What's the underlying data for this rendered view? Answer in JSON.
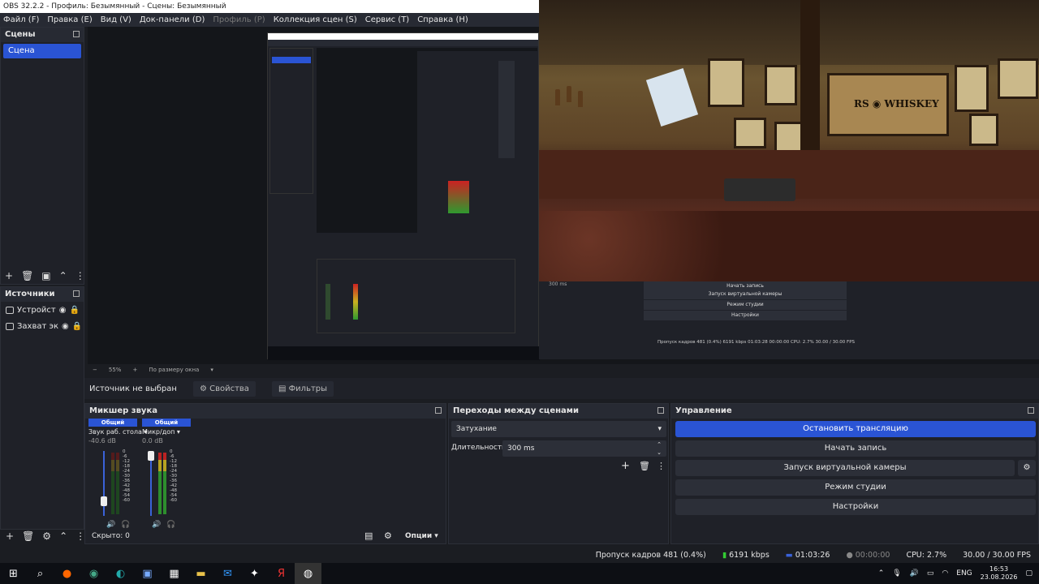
{
  "window": {
    "title": "OBS 32.2.2 - Профиль: Безымянный - Сцены: Безымянный"
  },
  "menu": {
    "items": [
      {
        "label": "Файл (F)",
        "disabled": false
      },
      {
        "label": "Правка (E)",
        "disabled": false
      },
      {
        "label": "Вид (V)",
        "disabled": false
      },
      {
        "label": "Док-панели (D)",
        "disabled": false
      },
      {
        "label": "Профиль (P)",
        "disabled": true
      },
      {
        "label": "Коллекция сцен (S)",
        "disabled": false
      },
      {
        "label": "Сервис (T)",
        "disabled": false
      },
      {
        "label": "Справка (H)",
        "disabled": false
      }
    ]
  },
  "scenes": {
    "title": "Сцены",
    "items": [
      "Сцена"
    ]
  },
  "sources": {
    "title": "Источники",
    "items": [
      "Устройст",
      "Захват эк"
    ]
  },
  "zoom": {
    "value": "55%",
    "mode": "По размеру окна"
  },
  "source_bar": {
    "status": "Источник не выбран",
    "properties": "Свойства",
    "filters": "Фильтры"
  },
  "mixer": {
    "title": "Микшер звука",
    "hidden": "Скрыто: 0",
    "options": "Опции",
    "channels": [
      {
        "tag": "Общий",
        "name": "Звук раб. стола",
        "db": "-40.6 dB",
        "volume": 0.18
      },
      {
        "tag": "Общий",
        "name": "Микр/доп",
        "db": "0.0 dB",
        "volume": 1.0
      }
    ],
    "scale": [
      "0",
      "-6",
      "-12",
      "-18",
      "-24",
      "-30",
      "-36",
      "-42",
      "-48",
      "-54",
      "-60"
    ]
  },
  "transitions": {
    "title": "Переходы между сценами",
    "type": "Затухание",
    "duration_label": "Длительность",
    "duration": "300 ms"
  },
  "controls": {
    "title": "Управление",
    "buttons": [
      "Остановить трансляцию",
      "Начать запись",
      "Запуск виртуальной камеры",
      "Режим студии",
      "Настройки"
    ]
  },
  "nested": {
    "bottom_labels": [
      "Начать запись",
      "Запуск виртуальной камеры",
      "Режим студии",
      "Настройки"
    ],
    "duration": "300 ms",
    "stats": "Пропуск кадров 481 (0.4%)   6191 kbps   01:03:28   00:00:00   CPU: 2.7%   30.00 / 30.00 FPS"
  },
  "status": {
    "dropped": "Пропуск кадров 481 (0.4%)",
    "bitrate": "6191 kbps",
    "stream_time": "01:03:26",
    "rec_time": "00:00:00",
    "cpu": "CPU: 2.7%",
    "fps": "30.00 / 30.00 FPS"
  },
  "tray": {
    "lang": "ENG",
    "time": "16:53",
    "date": "23.08.2026"
  },
  "colors": {
    "accent": "#2a54d4",
    "bg": "#1b1d22",
    "panel": "#1f2128"
  }
}
